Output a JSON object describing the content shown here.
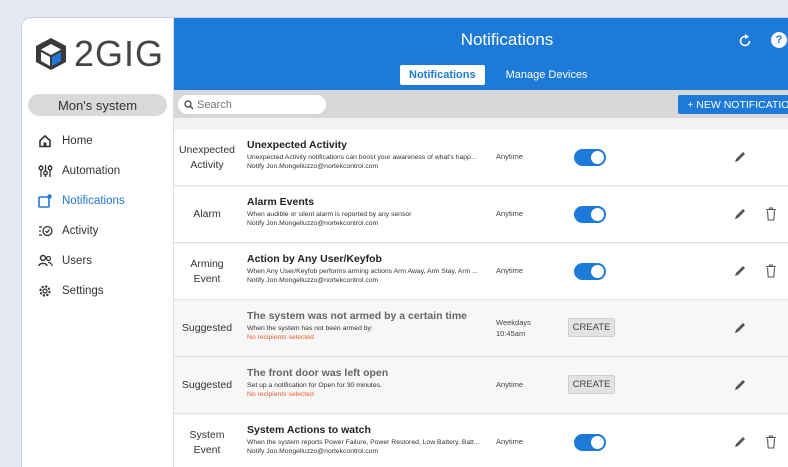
{
  "brand": {
    "name": "2GIG",
    "accent": "#1e7ad8",
    "warning": "#e85d2b"
  },
  "header": {
    "title": "Notifications",
    "refresh_icon": "refresh-icon",
    "help_label": "?"
  },
  "tabs": [
    {
      "label": "Notifications",
      "active": true
    },
    {
      "label": "Manage Devices",
      "active": false
    }
  ],
  "system": {
    "name": "Mon's system"
  },
  "sidebar": {
    "items": [
      {
        "label": "Home",
        "icon": "home-icon"
      },
      {
        "label": "Automation",
        "icon": "automation-icon"
      },
      {
        "label": "Notifications",
        "icon": "notifications-icon",
        "active": true
      },
      {
        "label": "Activity",
        "icon": "activity-icon"
      },
      {
        "label": "Users",
        "icon": "users-icon"
      },
      {
        "label": "Settings",
        "icon": "settings-icon"
      }
    ]
  },
  "search": {
    "placeholder": "Search"
  },
  "toolbar": {
    "new_label": "+ NEW NOTIFICATION"
  },
  "notifications": [
    {
      "type": "Unexpected Activity",
      "title": "Unexpected Activity",
      "description": "Unexpected Activity notifications can boost your awareness of what's happ...",
      "notify": "Notify Jon.Mongelluzzo@nortekcontrol.com",
      "schedule": "Anytime",
      "action": "toggle",
      "enabled": true,
      "deletable": false
    },
    {
      "type": "Alarm",
      "title": "Alarm Events",
      "description": "When audible or silent alarm is reported by any sensor",
      "notify": "Notify Jon.Mongelluzzo@nortekcontrol.com",
      "schedule": "Anytime",
      "action": "toggle",
      "enabled": true,
      "deletable": true
    },
    {
      "type": "Arming Event",
      "title": "Action by Any User/Keyfob",
      "description": "When Any User/Keyfob performs arming actions Arm Away, Arm Stay, Arm ...",
      "notify": "Notify Jon.Mongelluzzo@nortekcontrol.com",
      "schedule": "Anytime",
      "action": "toggle",
      "enabled": true,
      "deletable": true
    },
    {
      "type": "Suggested",
      "title": "The system was not armed by a certain time",
      "description": "When the system has not been armed by:",
      "notify": "No recipients selected",
      "schedule": "Weekdays",
      "schedule2": "10:45am",
      "action": "create",
      "create_label": "CREATE",
      "deletable": false
    },
    {
      "type": "Suggested",
      "title": "The front door was left open",
      "description": "Set up a notification for Open for 30 minutes.",
      "notify": "No recipients selected",
      "schedule": "Anytime",
      "action": "create",
      "create_label": "CREATE",
      "deletable": false
    },
    {
      "type": "System Event",
      "title": "System Actions to watch",
      "description": "When the system reports Power Failure, Power Restored, Low Battery, Batt...",
      "notify": "Notify Jon.Mongelluzzo@nortekcontrol.com",
      "schedule": "Anytime",
      "action": "toggle",
      "enabled": true,
      "deletable": true
    }
  ]
}
